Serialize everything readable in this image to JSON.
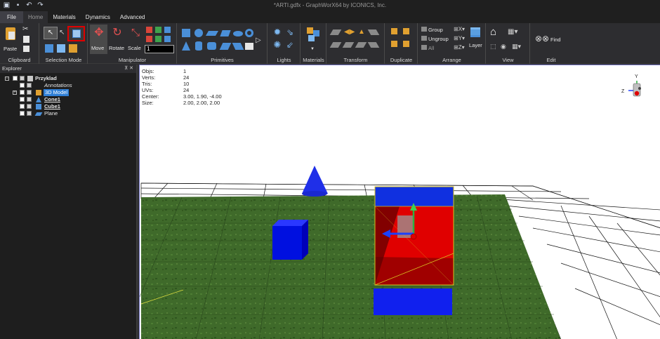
{
  "window": {
    "title": "*ARTI.gdfx - GraphWorX64 by ICONICS, Inc."
  },
  "tabs": [
    {
      "label": "File"
    },
    {
      "label": "Home"
    },
    {
      "label": "Materials"
    },
    {
      "label": "Dynamics"
    },
    {
      "label": "Advanced"
    }
  ],
  "ribbon": {
    "clipboard": {
      "label": "Clipboard",
      "paste": "Paste"
    },
    "selection_mode": {
      "label": "Selection Mode"
    },
    "manipulator": {
      "label": "Manipulator",
      "move": "Move",
      "rotate": "Rotate",
      "scale": "Scale",
      "step_value": "1"
    },
    "primitives": {
      "label": "Primitives"
    },
    "lights": {
      "label": "Lights"
    },
    "materials": {
      "label": "Materials"
    },
    "transform": {
      "label": "Transform"
    },
    "duplicate": {
      "label": "Duplicate"
    },
    "arrange": {
      "label": "Arrange",
      "group": "Group",
      "ungroup": "Ungroup",
      "all": "All",
      "layer": "Layer"
    },
    "view": {
      "label": "View"
    },
    "edit": {
      "label": "Edit",
      "find": "Find"
    }
  },
  "explorer": {
    "title": "Explorer",
    "items": [
      {
        "label": "Przyklad",
        "bold": true
      },
      {
        "label": "Annotations",
        "italic": true
      },
      {
        "label": "3D Model",
        "selected": true
      },
      {
        "label": "Cone1",
        "bold": true
      },
      {
        "label": "Cube1",
        "bold": true
      },
      {
        "label": "Plane"
      }
    ]
  },
  "stats": [
    {
      "key": "Objs:",
      "value": "1"
    },
    {
      "key": "Verts:",
      "value": "24"
    },
    {
      "key": "Tris:",
      "value": "10"
    },
    {
      "key": "UVs:",
      "value": "24"
    },
    {
      "key": "Center:",
      "value": "3.00, 1.90, -4.00"
    },
    {
      "key": "Size:",
      "value": "2.00, 2.00, 2.00"
    }
  ],
  "gizmo": {
    "y_label": "Y",
    "z_label": "Z"
  },
  "colors": {
    "accent": "#2f7fd6",
    "selection_red": "#e00000",
    "object_blue": "#0000ee",
    "grass": "#3f6a2a"
  }
}
